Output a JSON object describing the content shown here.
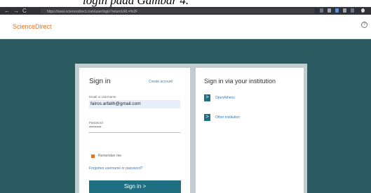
{
  "caption": {
    "text": "login pada Gambar 4."
  },
  "browser": {
    "back_glyph": "←",
    "forward_glyph": "→",
    "reload_glyph": "C",
    "url": "https://www.sciencedirect.com/user/login?returnURL=%2F"
  },
  "header": {
    "logo": "ScienceDirect",
    "help_glyph": "?"
  },
  "signin": {
    "title": "Sign in",
    "create_account": "Create account",
    "email_label": "Email or Username",
    "email_value": "fairos.arfalih@gmail.com",
    "password_label": "Password",
    "password_value": "••••••••••",
    "remember_label": "Remember me",
    "forgot_link": "Forgotten username or password?",
    "submit_label": "Sign in >"
  },
  "institution": {
    "title": "Sign in via your institution",
    "options": [
      {
        "label": "OpenAthens",
        "chevron": ">"
      },
      {
        "label": "Other institution",
        "chevron": ">"
      }
    ]
  },
  "colors": {
    "brand_orange": "#e9711c",
    "stage_teal": "#2b5a60",
    "button_teal": "#1f6f83",
    "link_blue": "#3a7ab5"
  }
}
